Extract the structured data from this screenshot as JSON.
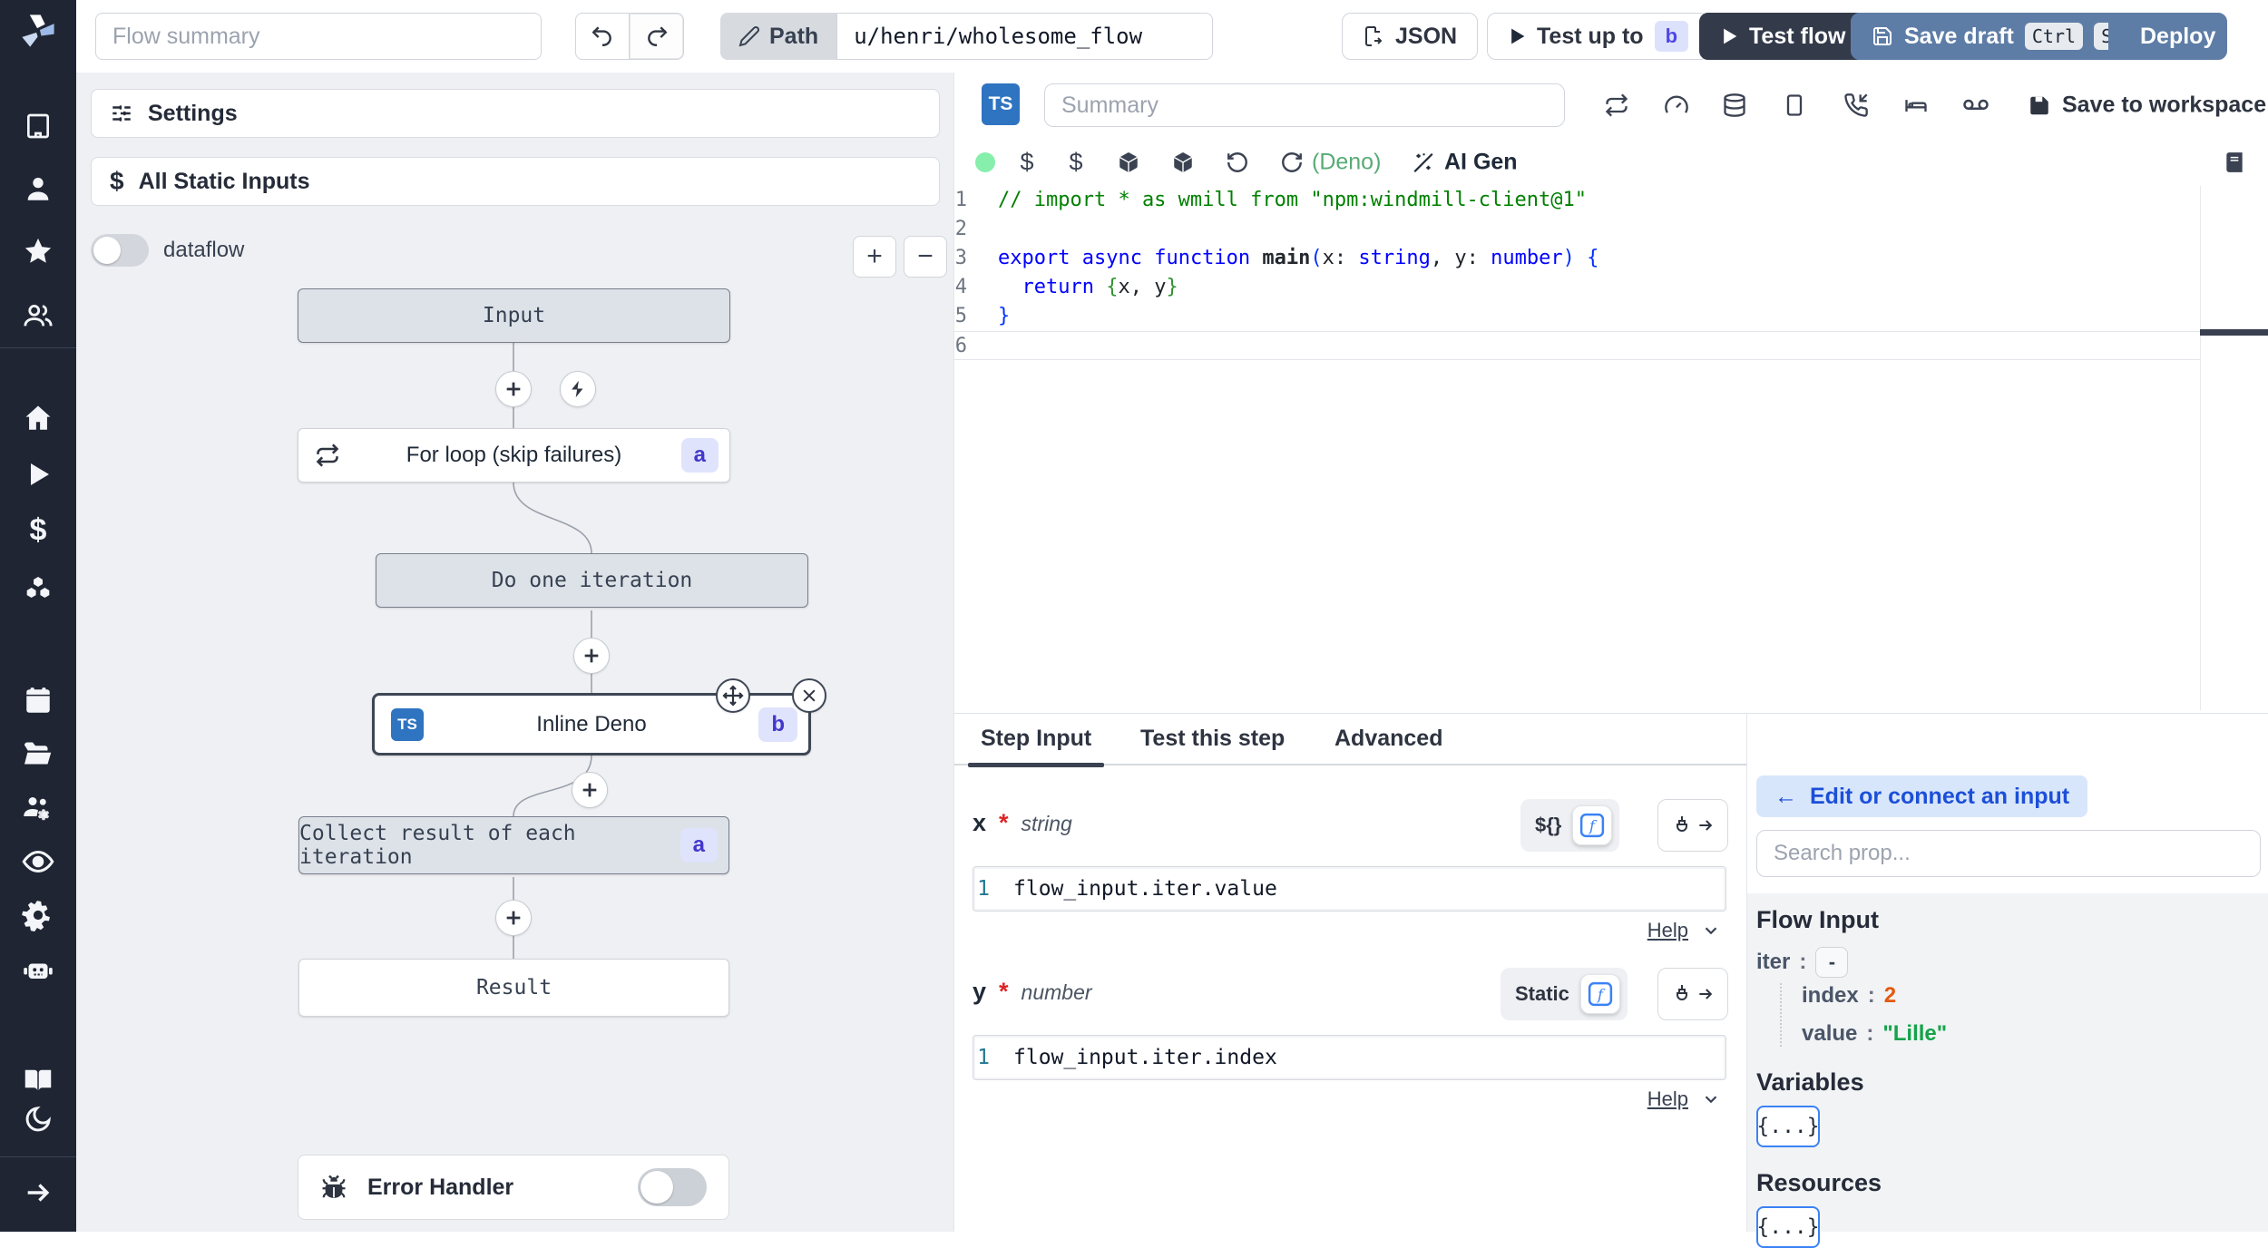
{
  "header": {
    "summary_placeholder": "Flow summary",
    "path_label": "Path",
    "path_value": "u/henri/wholesome_flow",
    "json_button": "JSON",
    "test_up_to_label": "Test up to",
    "test_up_to_badge": "b",
    "test_flow_label": "Test flow",
    "save_draft_label": "Save draft",
    "save_draft_kbd": [
      "Ctrl",
      "S"
    ],
    "deploy_label": "Deploy"
  },
  "sidebar": {
    "icons": [
      "building",
      "user",
      "star",
      "users",
      "home",
      "play",
      "dollar",
      "blocks",
      "calendar",
      "folder-open",
      "users-cog",
      "eye",
      "settings-gear",
      "robot",
      "book-open",
      "moon",
      "arrow-right"
    ]
  },
  "flow_panel": {
    "settings_label": "Settings",
    "all_static_inputs_label": "All Static Inputs",
    "dataflow_label": "dataflow",
    "zoom_in": "+",
    "zoom_out": "−",
    "nodes": {
      "input": "Input",
      "for_loop": "For loop (skip failures)",
      "for_loop_badge": "a",
      "do_one_iteration": "Do one iteration",
      "inline_deno": "Inline Deno",
      "inline_deno_badge": "b",
      "inline_deno_lang": "TS",
      "collect": "Collect result of each iteration",
      "collect_badge": "a",
      "result": "Result"
    },
    "error_handler_label": "Error Handler"
  },
  "editor": {
    "lang_badge": "TS",
    "summary_placeholder": "Summary",
    "runtime_label": "(Deno)",
    "ai_gen_label": "AI Gen",
    "save_to_workspace_label": "Save to workspace",
    "code_lines": [
      {
        "no": "1",
        "active": false,
        "tokens": [
          {
            "t": "// import * as wmill from \"npm:windmill-client@1\"",
            "c": "cm"
          }
        ]
      },
      {
        "no": "2",
        "active": false,
        "tokens": []
      },
      {
        "no": "3",
        "active": false,
        "tokens": [
          {
            "t": "export ",
            "c": "kw"
          },
          {
            "t": "async ",
            "c": "kw"
          },
          {
            "t": "function ",
            "c": "kw"
          },
          {
            "t": "main",
            "c": "fn"
          },
          {
            "t": "(",
            "c": "b1"
          },
          {
            "t": "x",
            "c": "pl"
          },
          {
            "t": ": ",
            "c": "pl"
          },
          {
            "t": "string",
            "c": "ty"
          },
          {
            "t": ", ",
            "c": "pl"
          },
          {
            "t": "y",
            "c": "pl"
          },
          {
            "t": ": ",
            "c": "pl"
          },
          {
            "t": "number",
            "c": "ty"
          },
          {
            "t": ")",
            "c": "b1"
          },
          {
            "t": " ",
            "c": "pl"
          },
          {
            "t": "{",
            "c": "b1"
          }
        ]
      },
      {
        "no": "4",
        "active": false,
        "tokens": [
          {
            "t": "  ",
            "c": "pl"
          },
          {
            "t": "return",
            "c": "kw"
          },
          {
            "t": " ",
            "c": "pl"
          },
          {
            "t": "{",
            "c": "b2"
          },
          {
            "t": "x, y",
            "c": "pl"
          },
          {
            "t": "}",
            "c": "b2"
          }
        ]
      },
      {
        "no": "5",
        "active": false,
        "tokens": [
          {
            "t": "}",
            "c": "b1"
          }
        ]
      },
      {
        "no": "6",
        "active": true,
        "tokens": []
      }
    ]
  },
  "step_panel": {
    "tabs": [
      "Step Input",
      "Test this step",
      "Advanced"
    ],
    "fields": [
      {
        "name": "x",
        "required": "*",
        "type": "string",
        "mode": "${}",
        "line_no": "1",
        "expr": "flow_input.iter.value",
        "help": "Help"
      },
      {
        "name": "y",
        "required": "*",
        "type": "number",
        "mode": "Static",
        "line_no": "1",
        "expr": "flow_input.iter.index",
        "help": "Help"
      }
    ]
  },
  "connect_panel": {
    "edit_arrow": "←",
    "edit_label": "Edit or connect an input",
    "search_placeholder": "Search prop...",
    "flow_input_title": "Flow Input",
    "tree": [
      {
        "key": "iter",
        "colon": ":",
        "value": "-",
        "kind": "object"
      },
      {
        "key": "index",
        "colon": ":",
        "value": "2",
        "kind": "number"
      },
      {
        "key": "value",
        "colon": ":",
        "value": "\"Lille\"",
        "kind": "string"
      }
    ],
    "variables_title": "Variables",
    "variables_button": "{...}",
    "resources_title": "Resources",
    "resources_button": "{...}"
  },
  "colors": {
    "rail_bg": "#1f2532",
    "steel_blue": "#5e7da6",
    "dark_navy": "#333b4b",
    "badge_indigo_bg": "#dfe3fc",
    "badge_indigo_text": "#4338ca",
    "ts_blue": "#2f74c0",
    "status_dot_green": "#86efac",
    "deno_green": "#58ab76",
    "value_orange": "#e2590f",
    "value_green": "#16a34a",
    "link_blue": "#1c4fd8"
  }
}
